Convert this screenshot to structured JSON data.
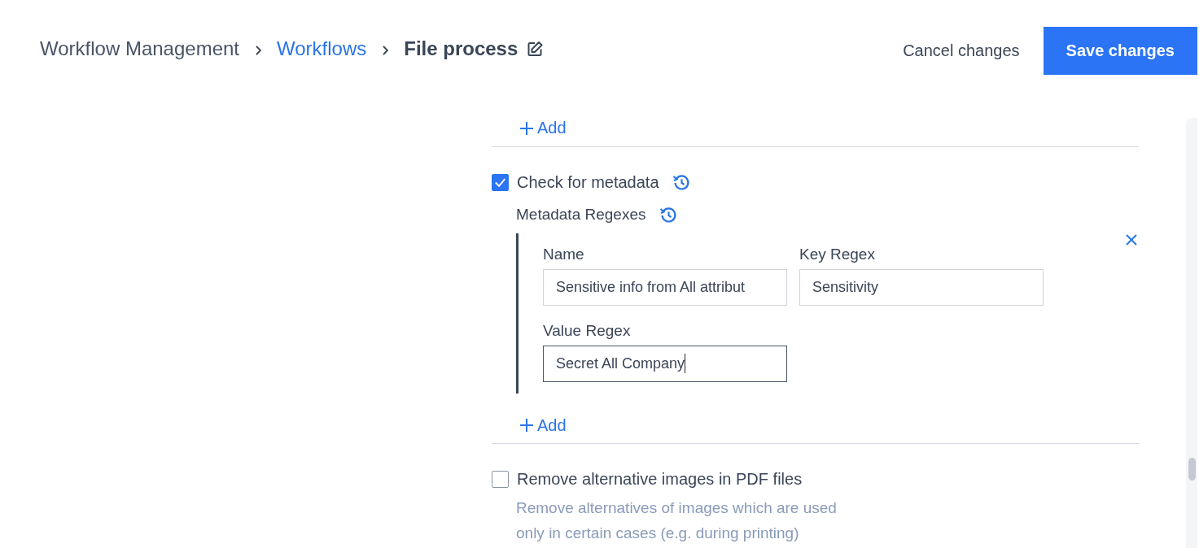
{
  "breadcrumb": [
    {
      "label": "Workflow Management",
      "kind": "root"
    },
    {
      "label": "Workflows",
      "kind": "link"
    },
    {
      "label": "File process",
      "kind": "current"
    }
  ],
  "actions": [
    {
      "label": "Cancel changes",
      "kind": "secondary"
    },
    {
      "label": "Save changes",
      "kind": "primary"
    }
  ],
  "top_add": {
    "label": "Add"
  },
  "metadata": {
    "label": "Check for metadata",
    "checked": true,
    "regexes_label": "Metadata Regexes",
    "entries": [
      {
        "fields": [
          {
            "label": "Name",
            "value": "Sensitive info from All attribut",
            "focused": false
          },
          {
            "label": "Key Regex",
            "value": "Sensitivity",
            "focused": false
          },
          {
            "label": "Value Regex",
            "value": "Secret All Company",
            "focused": true
          }
        ]
      }
    ],
    "add_label": "Add"
  },
  "pdf_option": {
    "label": "Remove alternative images in PDF files",
    "checked": false,
    "description": "Remove alternatives of images which are used only in certain cases (e.g. during printing)"
  }
}
